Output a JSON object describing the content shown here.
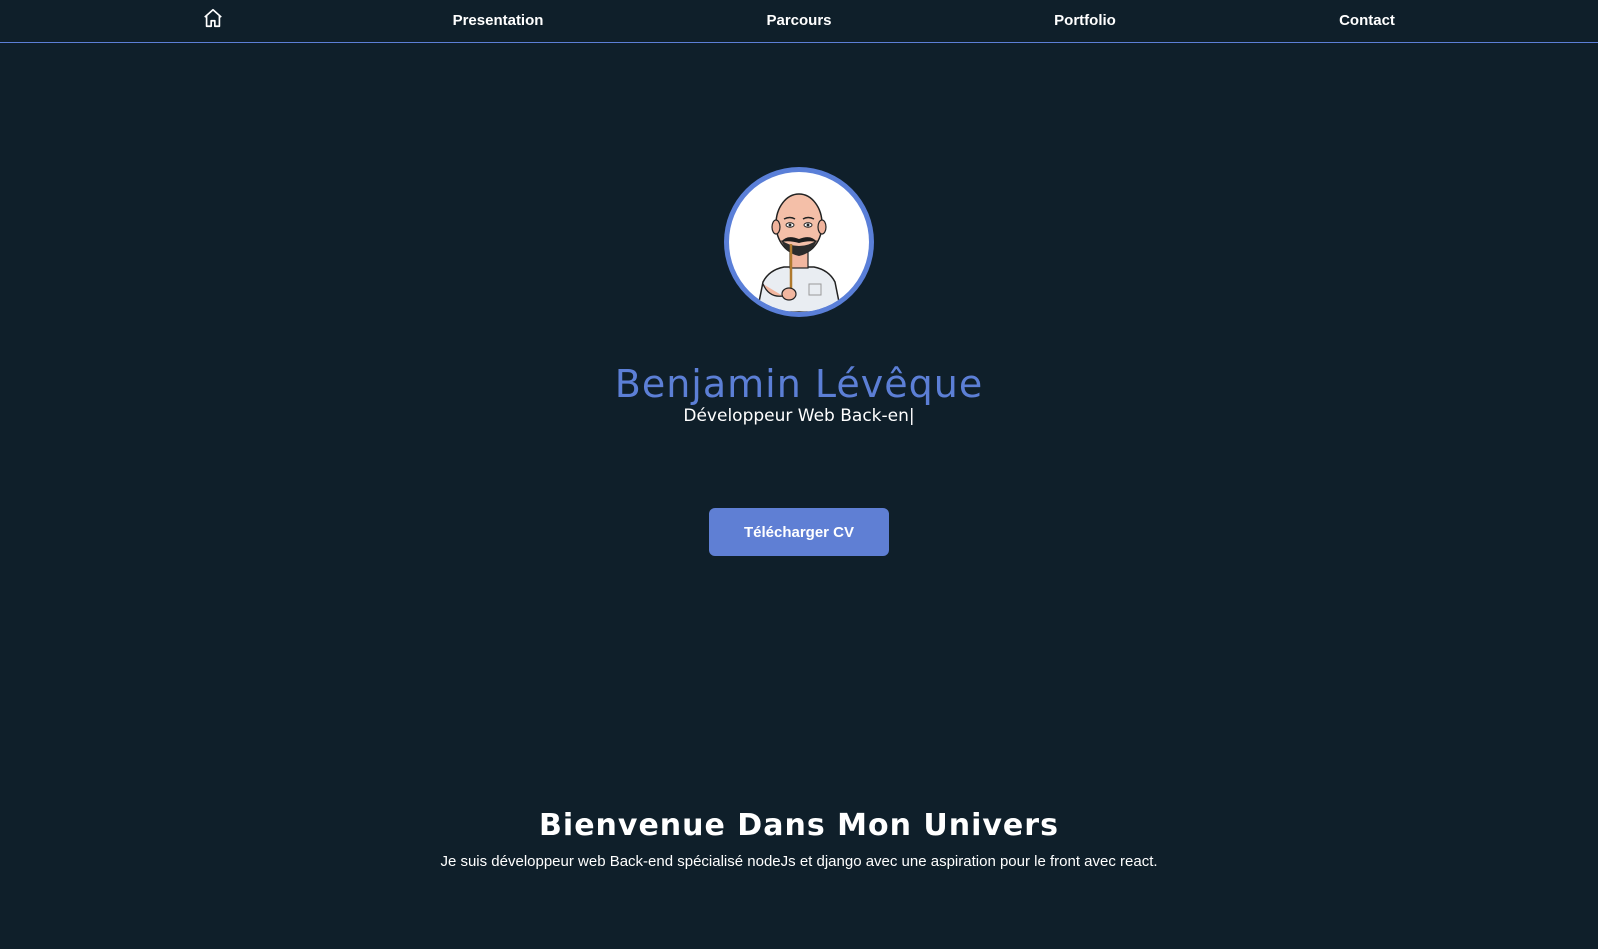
{
  "nav": {
    "home_icon": "home-icon",
    "links": [
      "Presentation",
      "Parcours",
      "Portfolio",
      "Contact"
    ]
  },
  "hero": {
    "avatar_icon": "bitmoji-avatar",
    "name": "Benjamin Lévêque",
    "subtitle": "Développeur Web Back-en|",
    "cv_button": "Télécharger CV"
  },
  "welcome": {
    "title": "Bienvenue Dans Mon Univers",
    "text": "Je suis développeur web Back-end spécialisé nodeJs et django avec une aspiration pour le front avec react."
  },
  "colors": {
    "background": "#0f1f2a",
    "accent": "#5c7fd6",
    "text": "#ffffff"
  }
}
